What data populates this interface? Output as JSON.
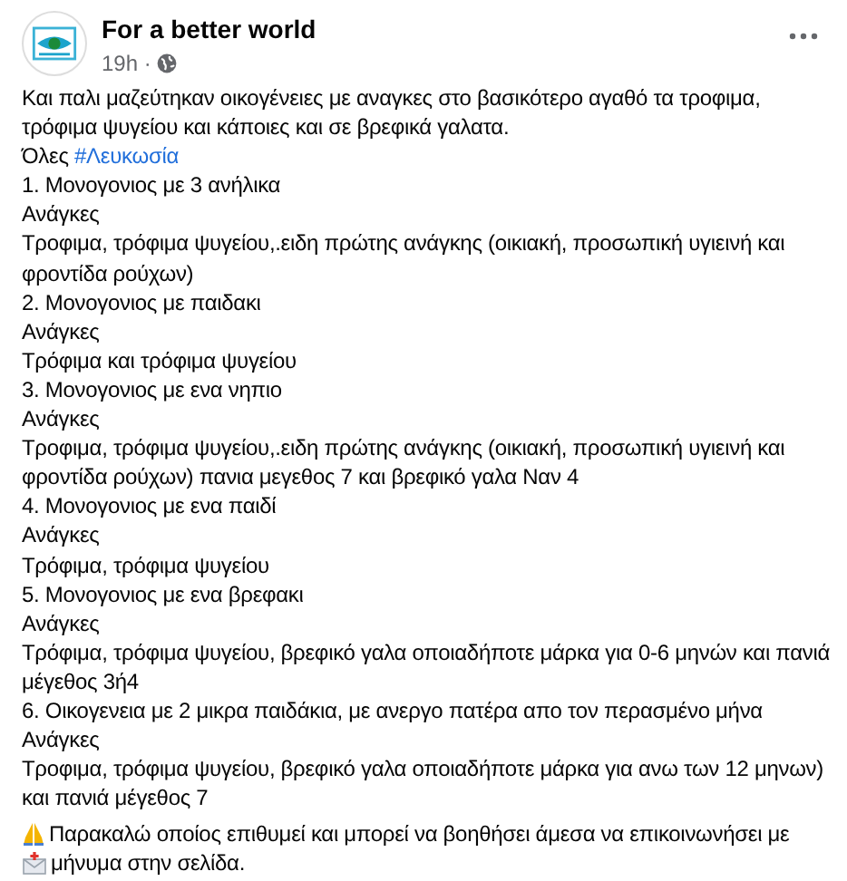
{
  "post": {
    "author": "For a better world",
    "time": "19h ·",
    "intro": [
      "Και παλι μαζεύτηκαν οικογένειες με αναγκες στο βασικότερο αγαθό τα τροφιμα, τρόφιμα ψυγείου και κάποιες και σε βρεφικά γαλατα."
    ],
    "location": {
      "prefix": "Όλες",
      "hashtag": "#Λευκωσία"
    },
    "lines": [
      "1. Μονογονιος με 3 ανήλικα",
      "Ανάγκες",
      "Τροφιμα,  τρόφιμα ψυγείου,.ειδη πρώτης ανάγκης (οικιακή, προσωπική υγιεινή και φροντίδα ρούχων)",
      "2. Μονογονιος με παιδακι",
      "Ανάγκες",
      "Τρόφιμα και τρόφιμα ψυγείου",
      "3. Μονογονιος με ενα νηπιο",
      "Ανάγκες",
      "Τροφιμα,  τρόφιμα ψυγείου,.ειδη πρώτης ανάγκης (οικιακή, προσωπική υγιεινή και φροντίδα ρούχων) πανια μεγεθος 7 και βρεφικό γαλα Ναν 4",
      "4. Μονογονιος με ενα παιδί",
      "Ανάγκες",
      "Τρόφιμα, τρόφιμα ψυγείου",
      "5. Μονογονιος με ενα βρεφακι",
      "Ανάγκες",
      "Τρόφιμα, τρόφιμα ψυγείου, βρεφικό γαλα οποιαδήποτε μάρκα για 0-6 μηνών και πανιά μέγεθος 3ή4",
      "6. Οικογενεια με 2 μικρα παιδάκια, με ανεργο πατέρα απο τον περασμένο μήνα",
      "Ανάγκες",
      "Τροφιμα, τρόφιμα ψυγείου, βρεφικό γαλα οποιαδήποτε μάρκα για ανω των 12 μηνων) και πανιά μέγεθος 7"
    ],
    "closing": [
      "Παρακαλώ οποίος επιθυμεί και μπορεί να βοηθήσει άμεσα να επικοινωνήσει με",
      "μήνυμα στην σελίδα."
    ]
  }
}
